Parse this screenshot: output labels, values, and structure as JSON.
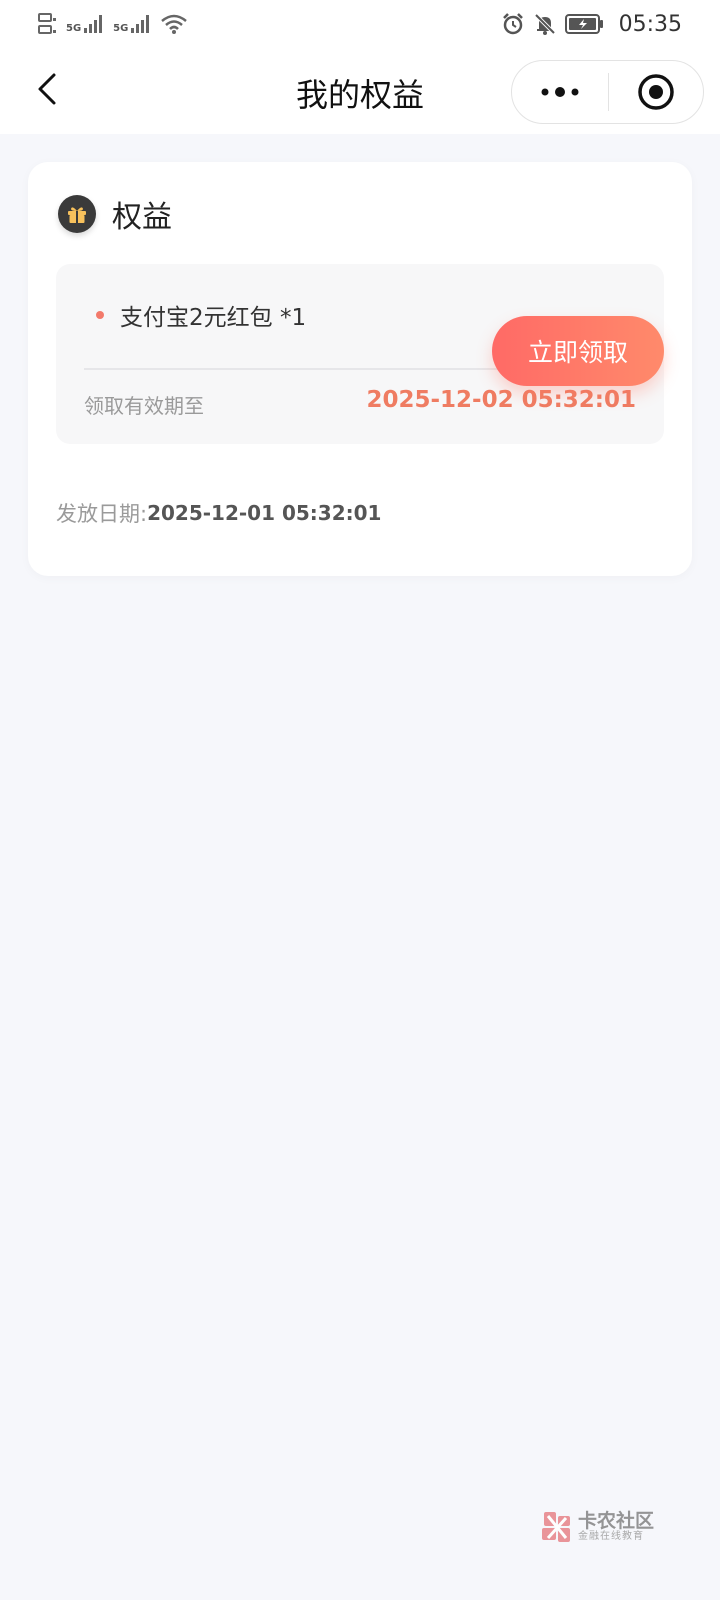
{
  "status_bar": {
    "time": "05:35",
    "network_1": "5G",
    "network_2": "5G",
    "icons": [
      "sim-icon",
      "signal-icon",
      "signal-icon",
      "wifi-icon",
      "alarm-icon",
      "mute-icon",
      "battery-icon"
    ]
  },
  "header": {
    "title": "我的权益"
  },
  "card": {
    "title": "权益",
    "benefit_item": "支付宝2元红包 *1",
    "valid_label": "领取有效期至",
    "valid_value": "2025-12-02 05:32:01",
    "issue_label": "发放日期:",
    "issue_value": "2025-12-01 05:32:01",
    "claim_button": "立即领取"
  },
  "watermark": {
    "main": "卡农社区",
    "sub": "金融在线教育"
  },
  "colors": {
    "accent": "#ff6a66",
    "value_highlight": "#ef7c62",
    "background": "#f6f7fb"
  }
}
